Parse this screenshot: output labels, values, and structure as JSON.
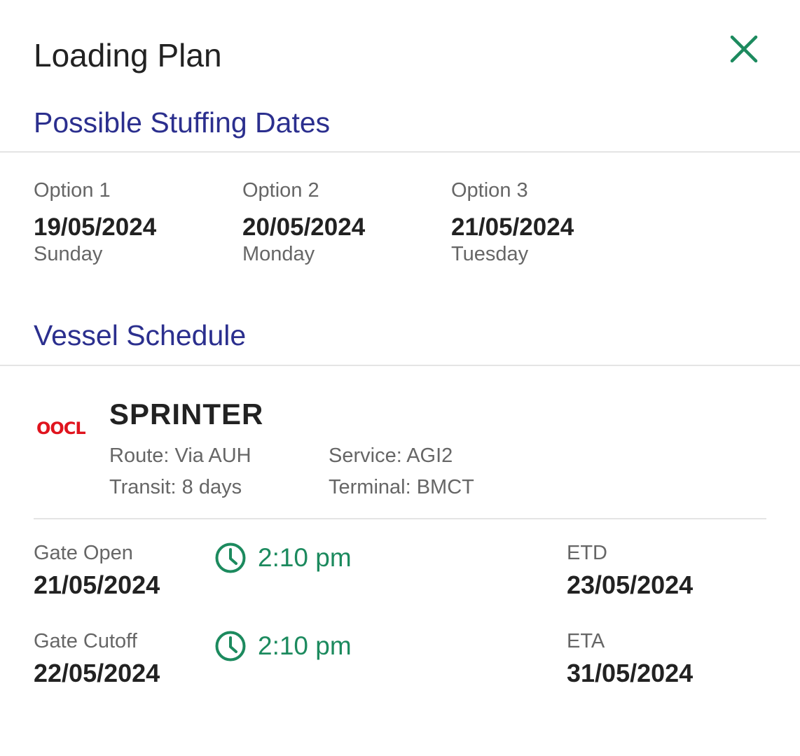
{
  "header": {
    "title": "Loading Plan",
    "close_icon": "close-icon",
    "accent_color": "#1c8a5e"
  },
  "stuffing": {
    "title": "Possible Stuffing Dates",
    "options": [
      {
        "label": "Option 1",
        "date": "19/05/2024",
        "day": "Sunday"
      },
      {
        "label": "Option 2",
        "date": "20/05/2024",
        "day": "Monday"
      },
      {
        "label": "Option 3",
        "date": "21/05/2024",
        "day": "Tuesday"
      }
    ]
  },
  "vessel": {
    "title": "Vessel Schedule",
    "carrier_logo": "OOCL",
    "name": "SPRINTER",
    "route": "Route: Via AUH",
    "transit": "Transit: 8 days",
    "service": "Service: AGI2",
    "terminal": "Terminal: BMCT"
  },
  "schedule": {
    "gate_open": {
      "label": "Gate Open",
      "date": "21/05/2024",
      "time": "2:10 pm"
    },
    "gate_cutoff": {
      "label": "Gate Cutoff",
      "date": "22/05/2024",
      "time": "2:10 pm"
    },
    "etd": {
      "label": "ETD",
      "date": "23/05/2024"
    },
    "eta": {
      "label": "ETA",
      "date": "31/05/2024"
    },
    "clock_icon": "clock-icon"
  },
  "colors": {
    "section_title": "#2b2f8e",
    "time": "#1c8a5e",
    "logo": "#e0141e"
  }
}
